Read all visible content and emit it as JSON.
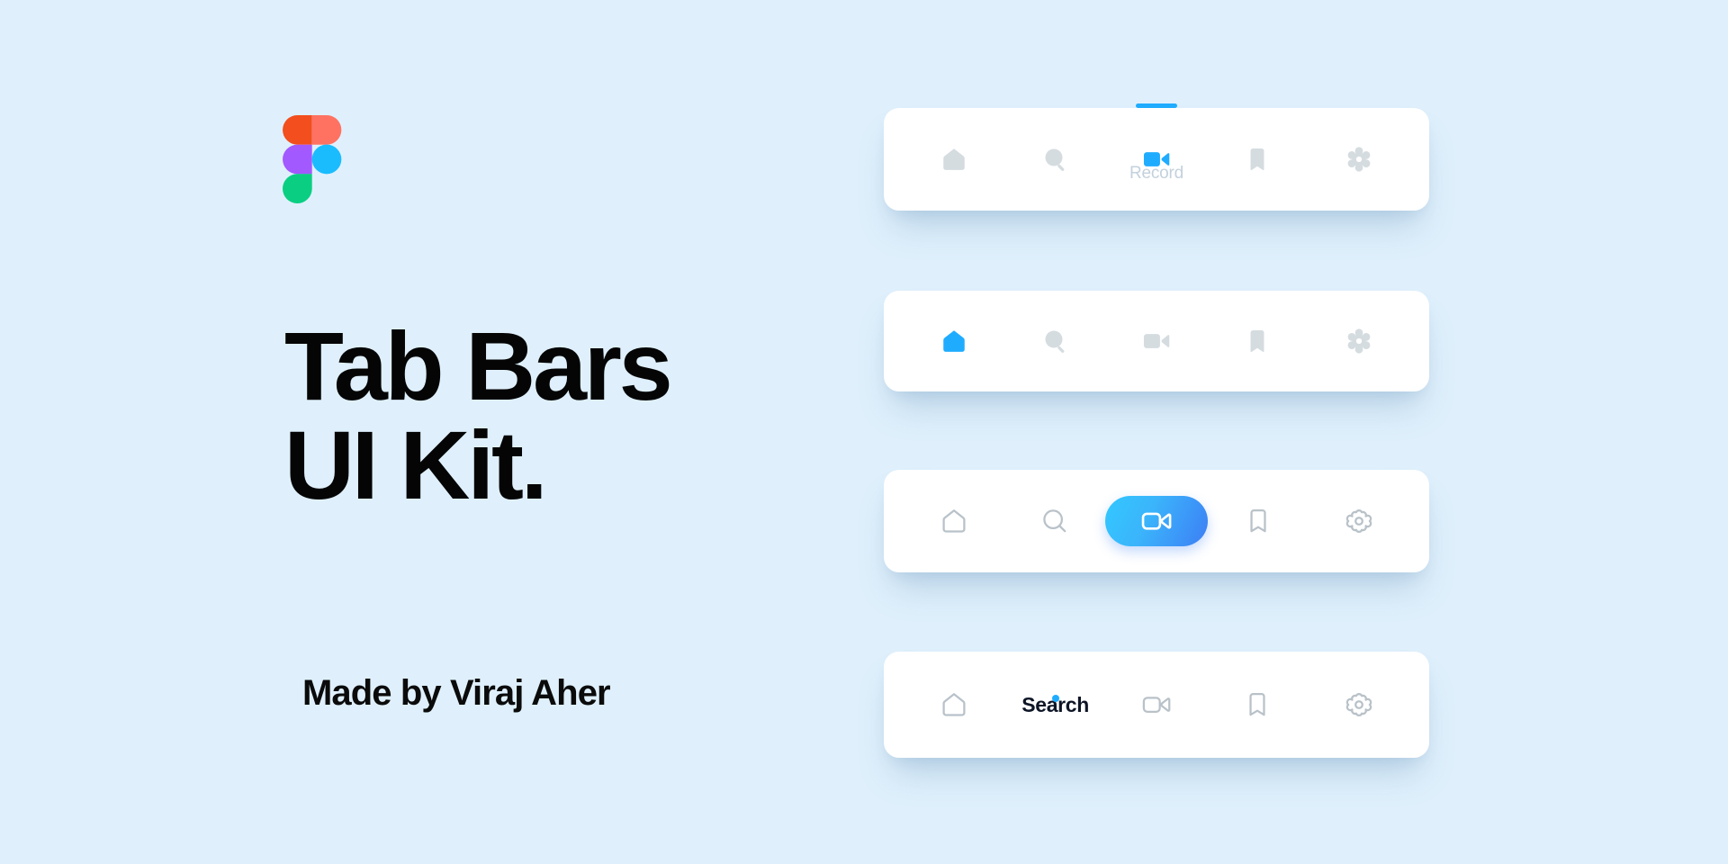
{
  "background_color": "#dff0fc",
  "brand": {
    "logo_name": "figma-logo",
    "logo_colors": {
      "orange": "#f24e1e",
      "salmon": "#ff7262",
      "purple": "#a259ff",
      "blue": "#1abcfe",
      "green": "#0acf83"
    }
  },
  "hero": {
    "title_line_1": "Tab Bars",
    "title_line_2": "UI Kit.",
    "byline": "Made by Viraj Aher",
    "title_color": "#050505",
    "byline_color": "#0b0b0b"
  },
  "theme": {
    "active_blue": "#1facff",
    "inactive_grey": "#d5dce0",
    "outline_grey": "#b9c2c9",
    "label_grey": "#c3d1dc",
    "card_white": "#ffffff",
    "gradient_from": "#32c8ff",
    "gradient_to": "#3d7ef5",
    "text_dark": "#0d1526"
  },
  "tab_bars": [
    {
      "id": "tab-bar-filled-indicator",
      "style": "filled",
      "active_index": 2,
      "active_indicator": "top-bar",
      "active_label": "Record",
      "items": [
        {
          "icon": "home-icon",
          "label": "Home",
          "active": false
        },
        {
          "icon": "search-icon",
          "label": "Search",
          "active": false
        },
        {
          "icon": "video-camera-icon",
          "label": "Record",
          "active": true
        },
        {
          "icon": "bookmark-icon",
          "label": "Saved",
          "active": false
        },
        {
          "icon": "gear-icon",
          "label": "Settings",
          "active": false
        }
      ]
    },
    {
      "id": "tab-bar-filled-plain",
      "style": "filled",
      "active_index": 0,
      "active_indicator": "none",
      "active_label": "",
      "items": [
        {
          "icon": "home-icon",
          "label": "Home",
          "active": true
        },
        {
          "icon": "search-icon",
          "label": "Search",
          "active": false
        },
        {
          "icon": "video-camera-icon",
          "label": "Record",
          "active": false
        },
        {
          "icon": "bookmark-icon",
          "label": "Saved",
          "active": false
        },
        {
          "icon": "gear-icon",
          "label": "Settings",
          "active": false
        }
      ]
    },
    {
      "id": "tab-bar-outline-pill",
      "style": "outline",
      "active_index": 2,
      "active_indicator": "gradient-pill",
      "active_label": "",
      "items": [
        {
          "icon": "home-icon",
          "label": "Home",
          "active": false
        },
        {
          "icon": "search-icon",
          "label": "Search",
          "active": false
        },
        {
          "icon": "video-camera-icon",
          "label": "Record",
          "active": true
        },
        {
          "icon": "bookmark-icon",
          "label": "Saved",
          "active": false
        },
        {
          "icon": "gear-icon",
          "label": "Settings",
          "active": false
        }
      ]
    },
    {
      "id": "tab-bar-outline-text",
      "style": "outline",
      "active_index": 1,
      "active_indicator": "dot",
      "active_label": "Search",
      "items": [
        {
          "icon": "home-icon",
          "label": "Home",
          "active": false
        },
        {
          "icon": "search-icon",
          "label": "Search",
          "active": true
        },
        {
          "icon": "video-camera-icon",
          "label": "Record",
          "active": false
        },
        {
          "icon": "bookmark-icon",
          "label": "Saved",
          "active": false
        },
        {
          "icon": "gear-icon",
          "label": "Settings",
          "active": false
        }
      ]
    }
  ]
}
